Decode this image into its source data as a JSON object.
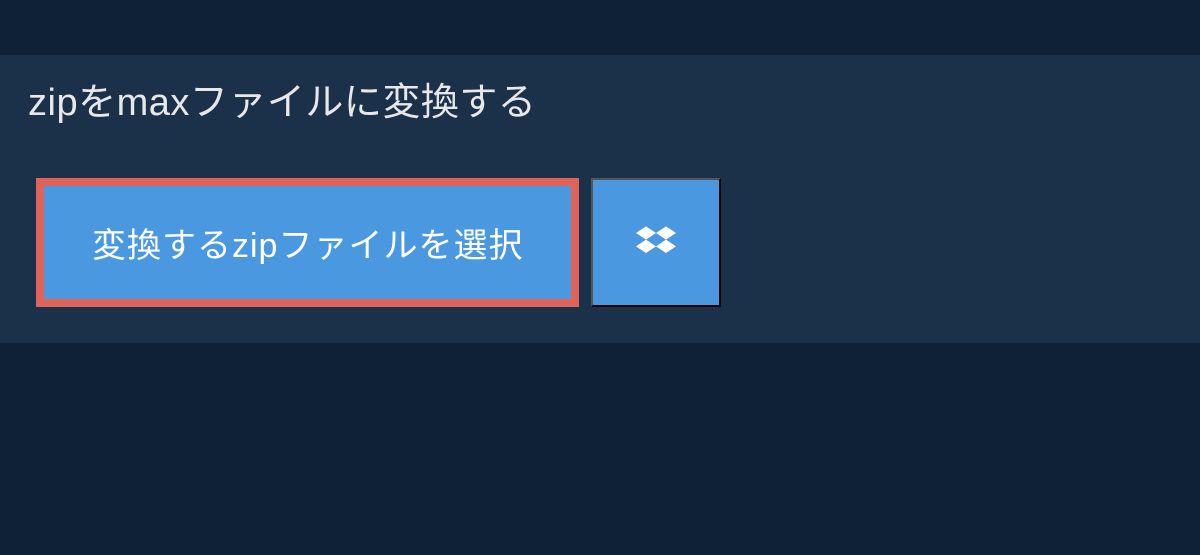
{
  "header": {
    "title": "zipをmaxファイルに変換する"
  },
  "actions": {
    "select_file_label": "変換するzipファイルを選択"
  },
  "colors": {
    "background": "#0f2136",
    "panel": "#1b3049",
    "button": "#4a98e0",
    "highlight_border": "#e0635a",
    "text": "#e8e8e8"
  }
}
